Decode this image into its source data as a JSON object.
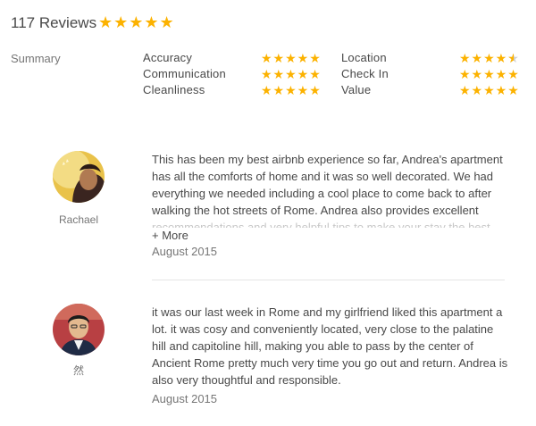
{
  "header": {
    "title": "117 Reviews",
    "stars": "★★★★★"
  },
  "summary": {
    "label": "Summary",
    "left": [
      {
        "name": "Accuracy",
        "stars": "★★★★★"
      },
      {
        "name": "Communication",
        "stars": "★★★★★"
      },
      {
        "name": "Cleanliness",
        "stars": "★★★★★"
      }
    ],
    "right": [
      {
        "name": "Location",
        "stars_full": "★★★★",
        "rating": 4.5
      },
      {
        "name": "Check In",
        "stars": "★★★★★"
      },
      {
        "name": "Value",
        "stars": "★★★★★"
      }
    ],
    "star_color": "#fcb200"
  },
  "reviews": [
    {
      "name": "Rachael",
      "text_visible": "This has been my best airbnb experience so far, Andrea's apartment has all the comforts of home and it was so well decorated. We had everything we needed including a cool place to come back to after walking the hot streets of Rome. Andrea also provides excellent",
      "text_faded": "recommendations and very helpful tips to make your stay the best, the area is",
      "more_label": "+ More",
      "date": "August 2015"
    },
    {
      "name": "然",
      "text": "it was our last week in Rome and my girlfriend liked this apartment a lot. it was cosy and conveniently located, very close to the palatine hill and capitoline hill, making you able to pass by the center of Ancient Rome pretty much very time you go out and return. Andrea is also very thoughtful and responsible.",
      "date": "August 2015"
    }
  ]
}
